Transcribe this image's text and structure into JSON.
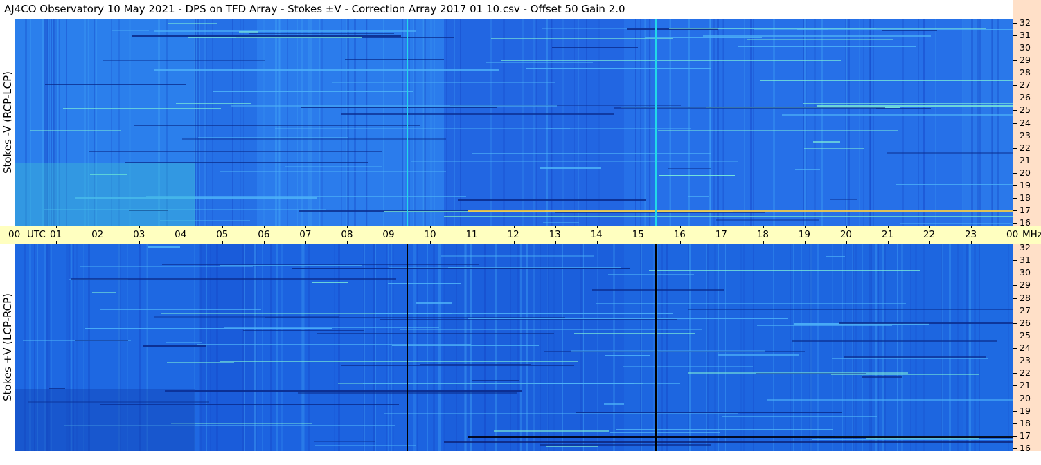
{
  "title": "AJ4CO Observatory  10 May 2021  -  DPS on TFD Array  -  Stokes ±V  -  Correction Array 2017 01 10.csv  -  Offset 50  Gain 2.0",
  "panels": [
    {
      "id": "top",
      "ylabel": "Stokes -V (RCP-LCP)",
      "marker_color": "#22d8e8"
    },
    {
      "id": "bottom",
      "ylabel": "Stokes +V (LCP-RCP)",
      "marker_color": "#000000"
    }
  ],
  "freq_labels": [
    "32",
    "31",
    "30",
    "29",
    "28",
    "27",
    "26",
    "25",
    "24",
    "23",
    "22",
    "21",
    "20",
    "19",
    "18",
    "17",
    "16"
  ],
  "time_axis": {
    "labels": [
      "00",
      "UTC",
      "01",
      "02",
      "03",
      "04",
      "05",
      "06",
      "07",
      "08",
      "09",
      "10",
      "11",
      "12",
      "13",
      "14",
      "15",
      "16",
      "17",
      "18",
      "19",
      "20",
      "21",
      "22",
      "23",
      "00",
      "MHz"
    ]
  },
  "colors": {
    "spectrogram_base": "#1e6ee8",
    "time_axis_bg": "#ffffc0",
    "freq_axis_bg": "#ffe0c8"
  }
}
